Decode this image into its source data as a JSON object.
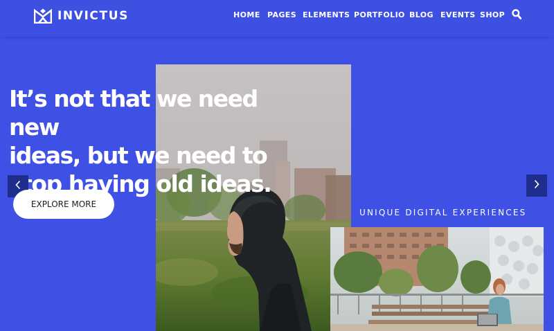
{
  "header": {
    "logo_text": "INVICTUS",
    "nav": [
      "HOME",
      "PAGES",
      "ELEMENTS",
      "PORTFOLIO",
      "BLOG",
      "EVENTS",
      "SHOP"
    ]
  },
  "hero": {
    "headline_lines": [
      "It’s not that we need new",
      "ideas, but we need to",
      "stop having old ideas."
    ],
    "cta_label": "EXPLORE MORE",
    "tagline": "UNIQUE DIGITAL EXPERIENCES"
  },
  "icons": {
    "logo": "invictus-crown-logo-icon",
    "search": "search-icon",
    "prev": "chevron-left-icon",
    "next": "chevron-right-icon"
  },
  "colors": {
    "brand_blue": "#3f51e5",
    "slider_arrow_bg": "#1f2d8c",
    "button_bg": "#ffffff",
    "button_text": "#1d1d1d"
  }
}
